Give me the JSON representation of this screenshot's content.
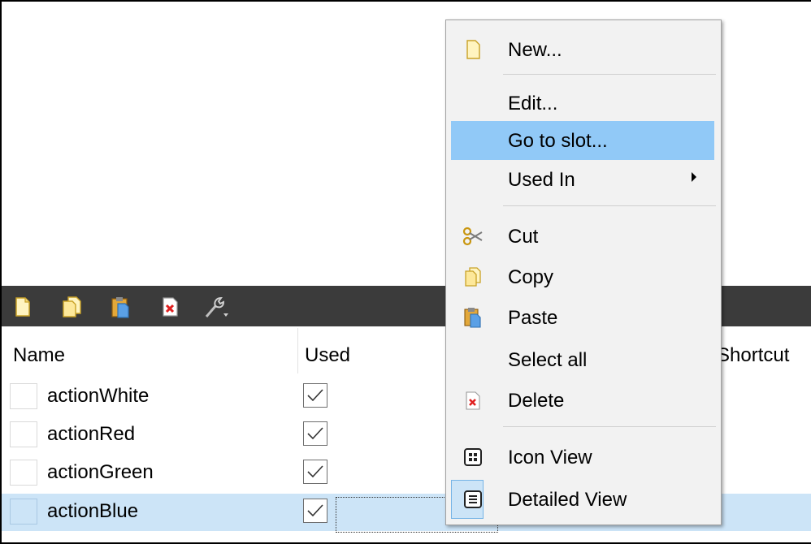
{
  "table": {
    "columns": [
      "Name",
      "Used",
      "Shortcut"
    ],
    "rows": [
      {
        "name": "actionWhite",
        "used": true,
        "selected": false
      },
      {
        "name": "actionRed",
        "used": true,
        "selected": false
      },
      {
        "name": "actionGreen",
        "used": true,
        "selected": false
      },
      {
        "name": "actionBlue",
        "used": true,
        "selected": true
      }
    ]
  },
  "toolbar": {
    "icons": [
      "new-icon",
      "copy-icon",
      "paste-icon",
      "delete-icon",
      "configure-icon"
    ]
  },
  "context_menu": {
    "items": {
      "new": "New...",
      "edit": "Edit...",
      "goto_slot": "Go to slot...",
      "used_in": "Used In",
      "cut": "Cut",
      "copy": "Copy",
      "paste": "Paste",
      "select_all": "Select all",
      "delete": "Delete",
      "icon_view": "Icon View",
      "detailed_view": "Detailed View"
    },
    "highlighted": "goto_slot",
    "checked_view": "detailed_view"
  },
  "colors": {
    "toolbar_bg": "#3b3b3b",
    "selection_row": "#cce4f7",
    "menu_highlight": "#91c9f7",
    "menu_bg": "#f2f2f2"
  }
}
